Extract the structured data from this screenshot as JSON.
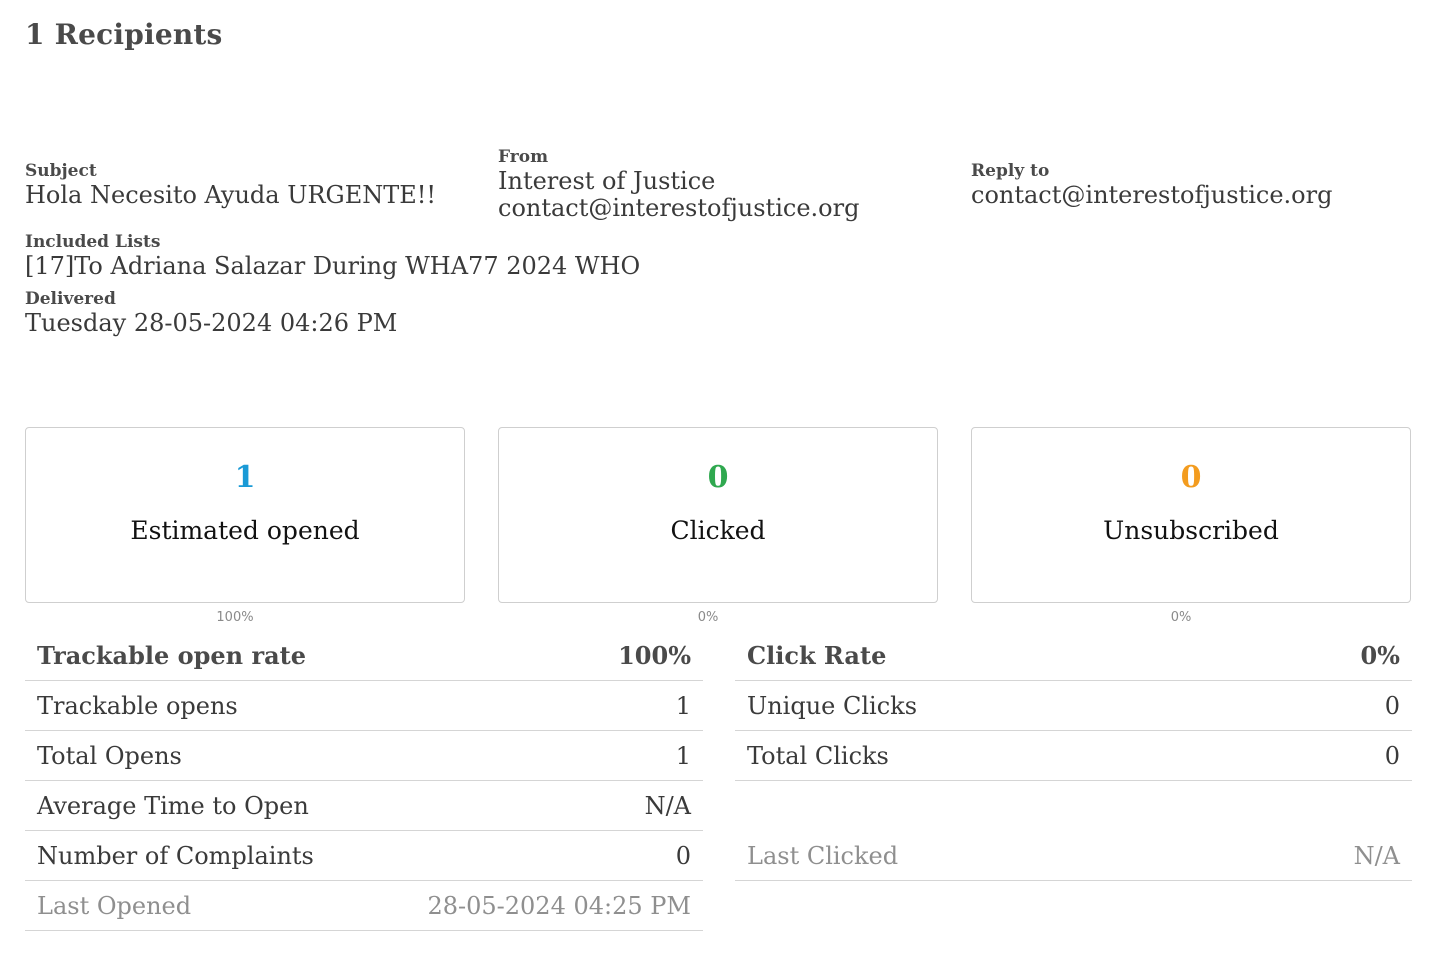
{
  "header": {
    "title": "1 Recipients"
  },
  "details": {
    "subject_label": "Subject",
    "subject_value": "Hola Necesito Ayuda URGENTE!!",
    "from_label": "From",
    "from_name": "Interest of Justice",
    "from_email": "contact@interestofjustice.org",
    "reply_to_label": "Reply to",
    "reply_to_value": "contact@interestofjustice.org",
    "included_lists_label": "Included Lists",
    "included_lists_value": "[17]To Adriana Salazar During WHA77 2024 WHO",
    "delivered_label": "Delivered",
    "delivered_value": "Tuesday 28-05-2024 04:26 PM"
  },
  "stats": [
    {
      "value": "1",
      "label": "Estimated opened",
      "percent": "100%",
      "color": "#1a9ad6"
    },
    {
      "value": "0",
      "label": "Clicked",
      "percent": "0%",
      "color": "#2fa84f"
    },
    {
      "value": "0",
      "label": "Unsubscribed",
      "percent": "0%",
      "color": "#f39c1f"
    }
  ],
  "open_table": {
    "header": {
      "label": "Trackable open rate",
      "value": "100%"
    },
    "rows": [
      {
        "label": "Trackable opens",
        "value": "1"
      },
      {
        "label": "Total Opens",
        "value": "1"
      },
      {
        "label": "Average Time to Open",
        "value": "N/A"
      },
      {
        "label": "Number of Complaints",
        "value": "0"
      }
    ],
    "last": {
      "label": "Last Opened",
      "value": "28-05-2024 04:25 PM"
    }
  },
  "click_table": {
    "header": {
      "label": "Click Rate",
      "value": "0%"
    },
    "rows": [
      {
        "label": "Unique Clicks",
        "value": "0"
      },
      {
        "label": "Total Clicks",
        "value": "0"
      }
    ],
    "last": {
      "label": "Last Clicked",
      "value": "N/A"
    }
  }
}
